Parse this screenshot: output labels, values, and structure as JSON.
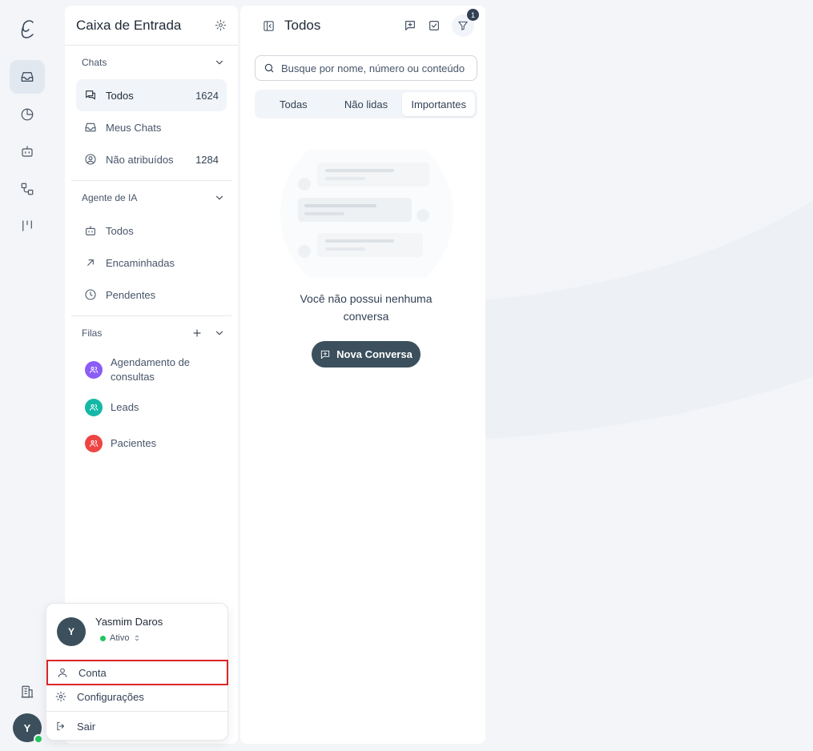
{
  "rail": {
    "items": [
      {
        "icon": "inbox-icon",
        "active": true
      },
      {
        "icon": "pie-chart-icon",
        "active": false
      },
      {
        "icon": "bot-icon",
        "active": false
      },
      {
        "icon": "workflow-icon",
        "active": false
      },
      {
        "icon": "kanban-icon",
        "active": false
      }
    ],
    "bottom_icon": "building-icon",
    "avatar_initial": "Y"
  },
  "inbox": {
    "title": "Caixa de Entrada",
    "sections": {
      "chats": {
        "label": "Chats",
        "items": [
          {
            "label": "Todos",
            "count": "1624"
          },
          {
            "label": "Meus Chats",
            "count": ""
          },
          {
            "label": "Não atribuídos",
            "count": "1284"
          }
        ]
      },
      "ai_agent": {
        "label": "Agente de IA",
        "items": [
          {
            "label": "Todos"
          },
          {
            "label": "Encaminhadas"
          },
          {
            "label": "Pendentes"
          }
        ]
      },
      "queues": {
        "label": "Filas",
        "items": [
          {
            "label": "Agendamento de consultas",
            "color": "#8b5cf6"
          },
          {
            "label": "Leads",
            "color": "#14b8a6"
          },
          {
            "label": "Pacientes",
            "color": "#ef4444"
          }
        ]
      }
    }
  },
  "chats": {
    "title": "Todos",
    "filter_badge": "1",
    "search_placeholder": "Busque por nome, número ou conteúdo",
    "tabs": [
      "Todas",
      "Não lidas",
      "Importantes"
    ],
    "active_tab": "Importantes",
    "empty_message": "Você não possui nenhuma conversa",
    "new_button": "Nova Conversa"
  },
  "account_menu": {
    "initial": "Y",
    "name": "Yasmim Daros",
    "status": "Ativo",
    "items": [
      "Conta",
      "Configurações",
      "Sair"
    ]
  },
  "colors": {
    "accent": "#3b4f5c",
    "online": "#22c55e",
    "highlight": "#dc2626"
  }
}
